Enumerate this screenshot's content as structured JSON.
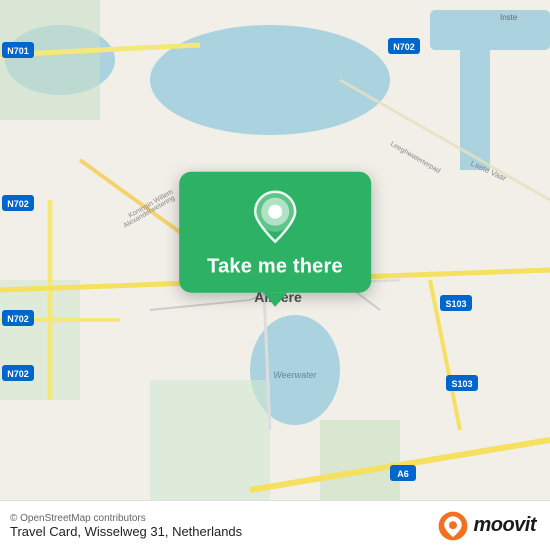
{
  "map": {
    "alt": "OpenStreetMap of Almere, Netherlands",
    "copyright": "© OpenStreetMap contributors",
    "address": "Travel Card, Wisselweg 31, Netherlands"
  },
  "popup": {
    "button_label": "Take me there",
    "pin_icon": "map-pin-icon"
  },
  "branding": {
    "name": "moovit",
    "logo_alt": "Moovit logo"
  }
}
